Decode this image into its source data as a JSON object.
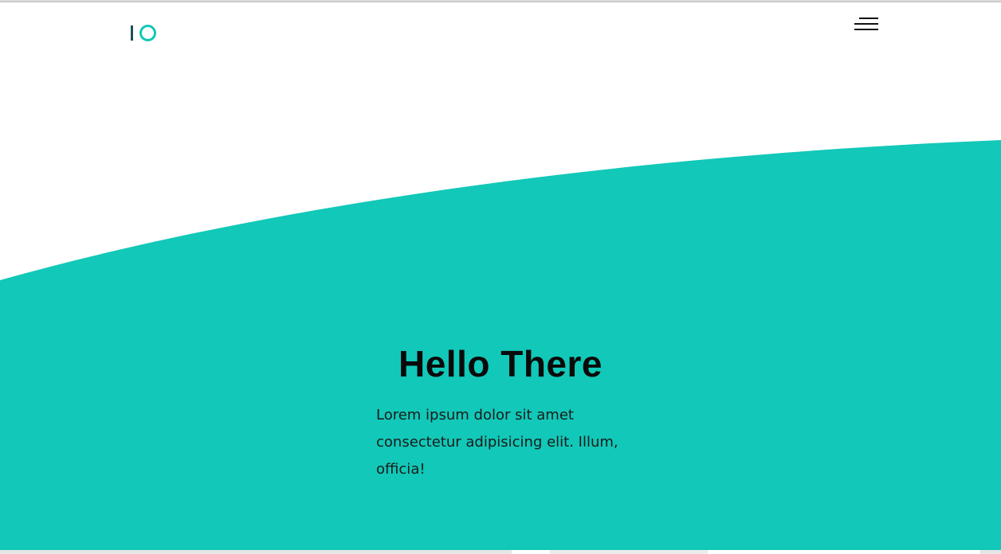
{
  "colors": {
    "accent": "#12c8b8",
    "logo_bar": "#1f4f57",
    "background": "#ffffff",
    "title": "#0a0a0a"
  },
  "header": {
    "logo_icon": "io-logo",
    "menu_icon": "hamburger-menu-icon"
  },
  "hero": {
    "title": "Hello There",
    "text": "Lorem ipsum dolor sit amet consectetur adipisicing elit. Illum, officia!"
  }
}
